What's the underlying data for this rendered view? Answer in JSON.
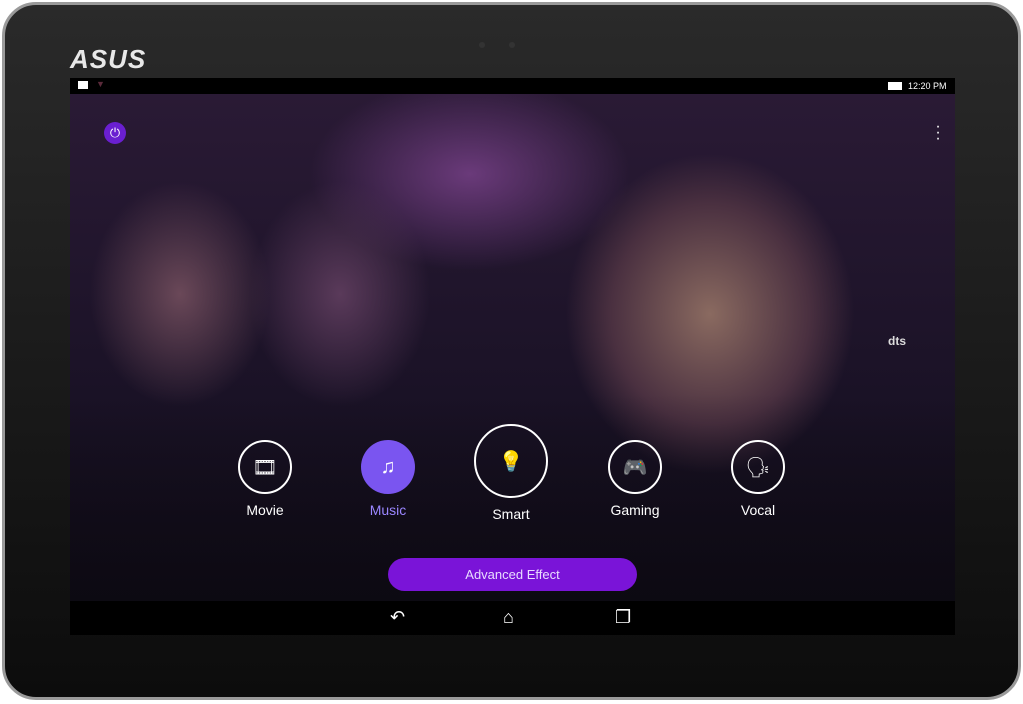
{
  "device": {
    "brand": "ASUS"
  },
  "status_bar": {
    "time": "12:20 PM"
  },
  "modes": [
    {
      "label": "Movie",
      "icon": "film-icon",
      "glyph": "🎞"
    },
    {
      "label": "Music",
      "icon": "music-note-icon",
      "glyph": "♫",
      "active": true
    },
    {
      "label": "Smart",
      "icon": "lightbulb-icon",
      "glyph": "💡"
    },
    {
      "label": "Gaming",
      "icon": "gamepad-icon",
      "glyph": "🎮"
    },
    {
      "label": "Vocal",
      "icon": "speaker-voice-icon",
      "glyph": "🗣"
    }
  ],
  "advanced_effect_label": "Advanced Effect",
  "dts_logo": "dts",
  "accent_color": "#7a14d8",
  "nav": {
    "back": "↶",
    "home": "⌂",
    "recent": "❐"
  }
}
